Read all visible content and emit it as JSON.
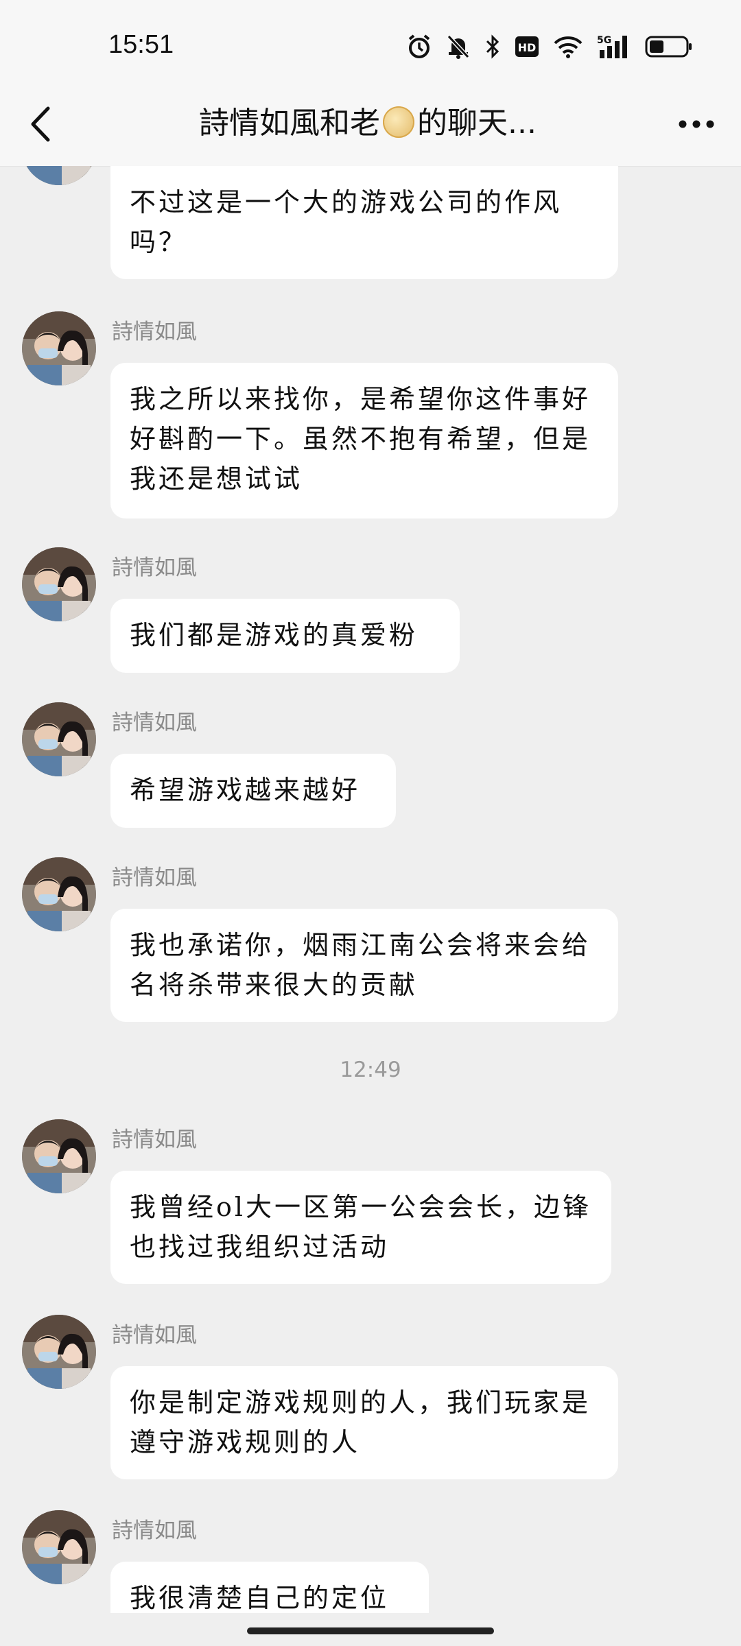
{
  "status": {
    "time": "15:51"
  },
  "header": {
    "title_before": "詩情如風和老",
    "title_after": "的聊天..."
  },
  "sender_name": "詩情如風",
  "messages": [
    {
      "text": "不过这是一个大的游戏公司的作风吗？",
      "show_sender": false
    },
    {
      "text": "我之所以来找你，是希望你这件事好好斟酌一下。虽然不抱有希望，但是我还是想试试",
      "show_sender": true
    },
    {
      "text": "我们都是游戏的真爱粉",
      "show_sender": true
    },
    {
      "text": "希望游戏越来越好",
      "show_sender": true
    },
    {
      "text": "我也承诺你，烟雨江南公会将来会给名将杀带来很大的贡献",
      "show_sender": true
    },
    {
      "text": "我曾经ol大一区第一公会会长，边锋也找过我组织过活动",
      "show_sender": true
    },
    {
      "text": "你是制定游戏规则的人，我们玩家是遵守游戏规则的人",
      "show_sender": true
    },
    {
      "text": "我很清楚自己的定位",
      "show_sender": true
    }
  ],
  "timestamp": "12:49"
}
